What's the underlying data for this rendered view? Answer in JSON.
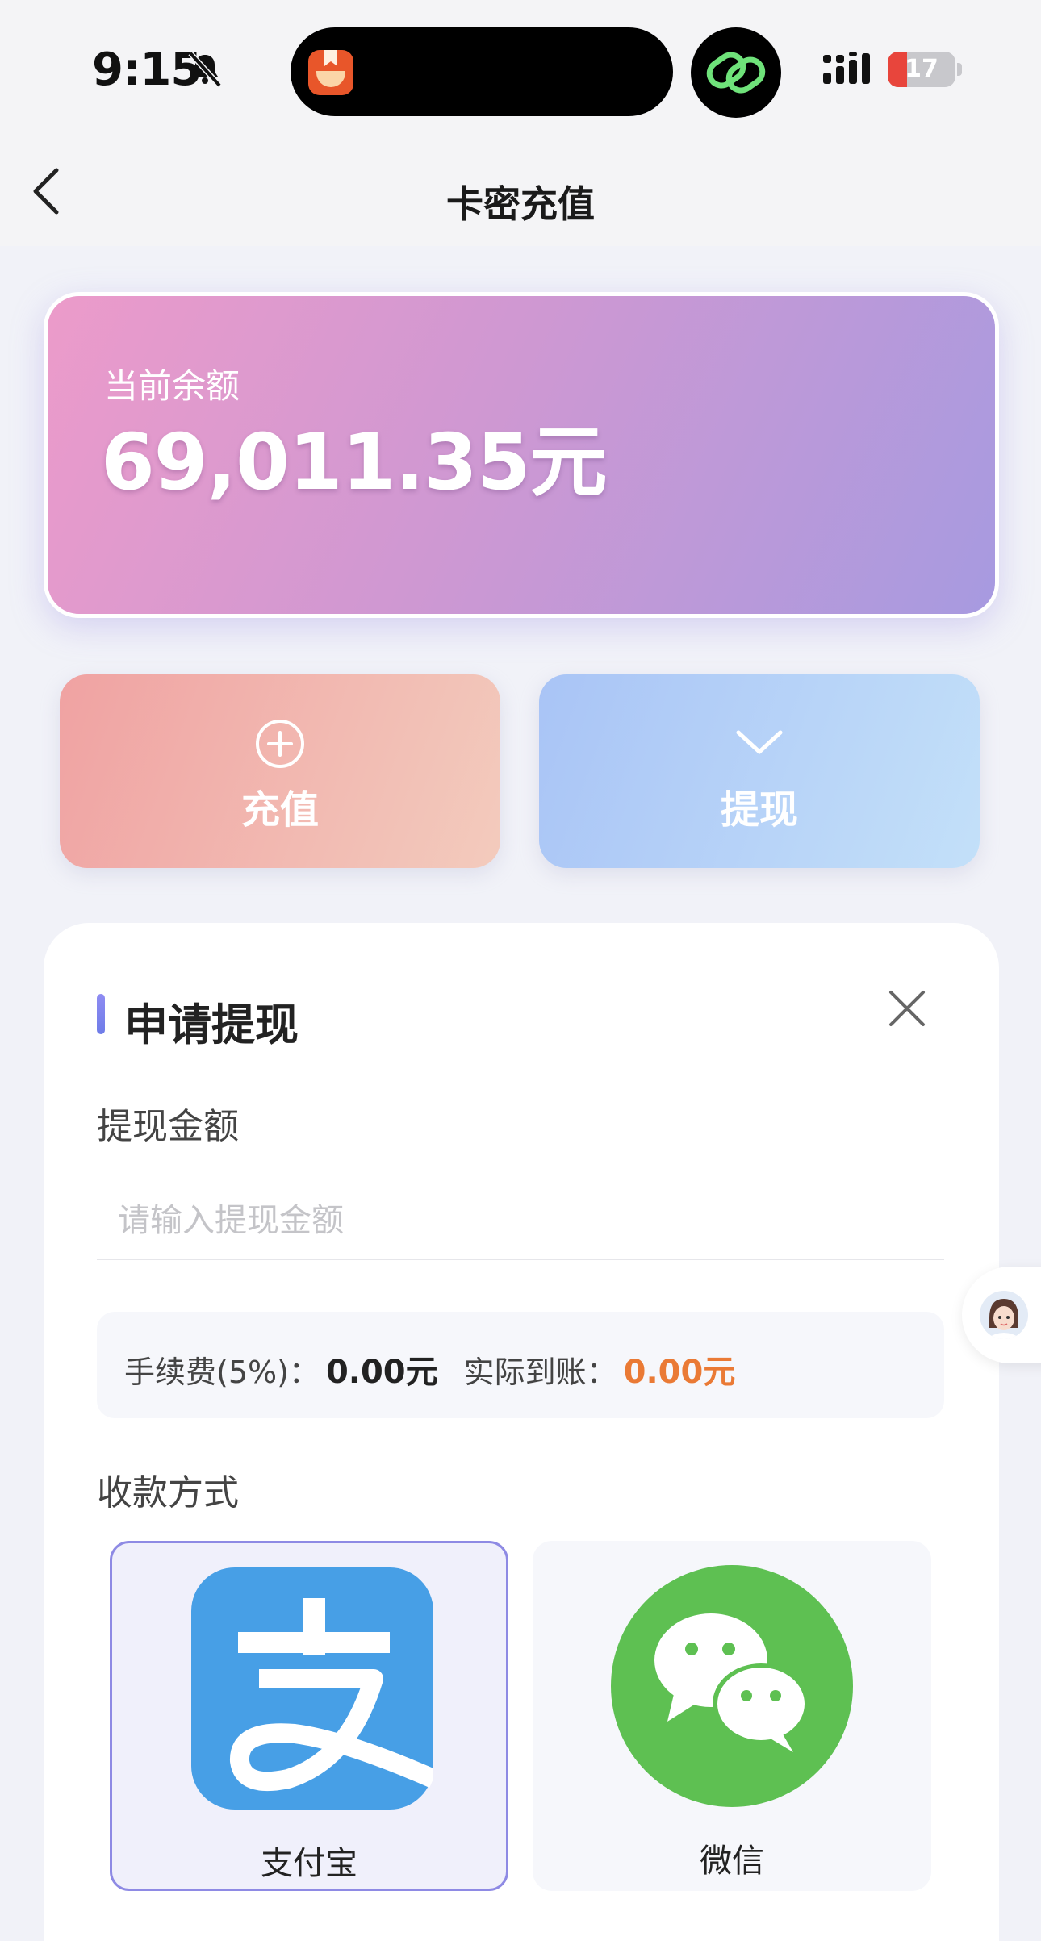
{
  "status_bar": {
    "time": "9:15",
    "battery": "17",
    "battery_level": 0.17
  },
  "nav": {
    "title": "卡密充值"
  },
  "balance_card": {
    "label": "当前余额",
    "amount": "69,011.35元"
  },
  "actions": {
    "recharge_label": "充值",
    "withdraw_label": "提现"
  },
  "withdraw_panel": {
    "title": "申请提现",
    "amount_label": "提现金额",
    "amount_placeholder": "请输入提现金额",
    "amount_value": "",
    "fee_label": "手续费(5%)：",
    "fee_value": "0.00元",
    "arrival_label": "实际到账：",
    "arrival_value": "0.00元",
    "method_label": "收款方式",
    "methods": [
      {
        "name": "支付宝",
        "icon": "alipay-icon",
        "selected": true
      },
      {
        "name": "微信",
        "icon": "wechat-icon",
        "selected": false
      }
    ]
  },
  "colors": {
    "accent": "#8e8ae4",
    "arrival": "#ea7a35",
    "alipay_blue": "#479fe6",
    "wechat_green": "#5ec052"
  }
}
